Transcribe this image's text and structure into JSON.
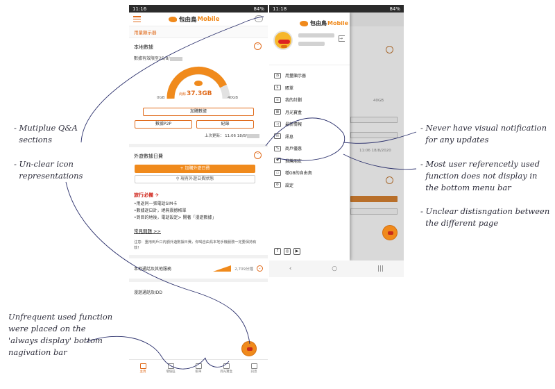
{
  "annotations": {
    "left_1": "- Mutiplue Q&A\n  sections",
    "left_2": "- Un-clear icon\n  representations",
    "left_3": "Unfrequent used function\nwere placed on the\n'always display' bottom\nnagivation bar",
    "right_1": "- Never have visual notification\n  for any updates",
    "right_2": "- Most user referencetly used\n  function does not display in\n  the bottom menu bar",
    "right_3": "- Unclear distisngation between\n  the different page"
  },
  "phone1": {
    "status_time": "11:16",
    "status_right": "84%",
    "logo_text": "包由鳥",
    "logo_mobile": "Mobile",
    "chat_glyph": "…",
    "page_header": "用量顯示器",
    "local_data_title": "本地數據",
    "validity": "數據有效限至25/8/",
    "gauge_min": "0GB",
    "gauge_max": "40GB",
    "gauge_prefix": "尚餘",
    "gauge_value": "37.3GB",
    "add_data_btn": "加購數據",
    "p2p_btn": "數據P2P",
    "record_btn": "紀錄",
    "last_updated": "上次更新： 11:06 18/8/",
    "roaming_title": "外遊數據日費",
    "add_roaming_btn": "+ 加購外遊日費",
    "view_roaming_btn": "現有外遊日費狀態",
    "travel_title": "旅行必備 ✈",
    "bullets": [
      "•用返同一張電話SIM卡",
      "•數據逐日計，絕無震撼帳單",
      "•到目的地後，電話設定> 開著「漫遊數據」"
    ],
    "faq": "常見問題 >>",
    "notice": "注意：重用到戶口內額外遊數據日費，你喝自由鳥本地手機服務一定要保持有效！",
    "local_calls": "本地通話及其他服務",
    "local_calls_value": "2,709分鐘",
    "roaming_idd": "漫遊通話及IDD",
    "nav": [
      "主頁",
      "增值區",
      "賬單",
      "月光寶盒",
      "訊息"
    ]
  },
  "phone2": {
    "status_time": "11:18",
    "status_right": "84%",
    "logo_text": "包由鳥",
    "logo_mobile": "Mobile",
    "bg_gb": "40GB",
    "bg_updated": "11:06 18/8/2020",
    "menu": [
      {
        "icon": "◔",
        "label": "用量顯示器"
      },
      {
        "icon": "$",
        "label": "賬單"
      },
      {
        "icon": "≡",
        "label": "我的計劃"
      },
      {
        "icon": "▦",
        "label": "月光寶盒"
      },
      {
        "icon": "◁",
        "label": "最新情報"
      },
      {
        "icon": "✉",
        "label": "訊息"
      },
      {
        "icon": "%",
        "label": "商戶優惠"
      },
      {
        "icon": "♥",
        "label": "推薦朋友"
      },
      {
        "icon": "▭",
        "label": "穩GB的自由鳥"
      },
      {
        "icon": "⚙",
        "label": "設定"
      }
    ],
    "social": [
      "f",
      "◎",
      "▶"
    ],
    "android_nav": [
      "‹",
      "○",
      "|||"
    ]
  }
}
